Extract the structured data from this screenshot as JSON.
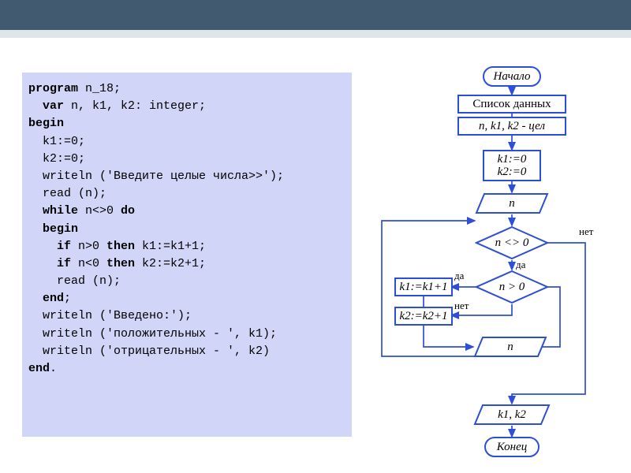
{
  "code": {
    "l1a": "program",
    "l1b": " n_18;",
    "l2a": "  var",
    "l2b": " n, k1, k2: integer;",
    "l3": "begin",
    "l4": "  k1:=0;",
    "l5": "  k2:=0;",
    "l6": "  writeln ('Введите целые числа>>');",
    "l7": "  read (n);",
    "l8a": "  while",
    "l8b": " n<>0 ",
    "l8c": "do",
    "l9": "  begin",
    "l10a": "    if",
    "l10b": " n>0 ",
    "l10c": "then",
    "l10d": " k1:=k1+1;",
    "l11a": "    if",
    "l11b": " n<0 ",
    "l11c": "then",
    "l11d": " k2:=k2+1;",
    "l12": "    read (n);",
    "l13a": "  end",
    "l13b": ";",
    "l14": "  writeln ('Введено:');",
    "l15": "  writeln ('положительных - ', k1);",
    "l16": "  writeln ('отрицательных - ', k2)",
    "l17a": "end",
    "l17b": "."
  },
  "flow": {
    "start": "Начало",
    "datalist": "Список данных",
    "vars": "n, k1, k2 - цел",
    "init": "k1:=0\nk2:=0",
    "read_n": "n",
    "cond1": "n <> 0",
    "cond2": "n > 0",
    "assign1": "k1:=k1+1",
    "assign2": "k2:=k2+1",
    "read_n2": "n",
    "output": "k1, k2",
    "end": "Конец",
    "yes": "да",
    "no": "нет"
  }
}
